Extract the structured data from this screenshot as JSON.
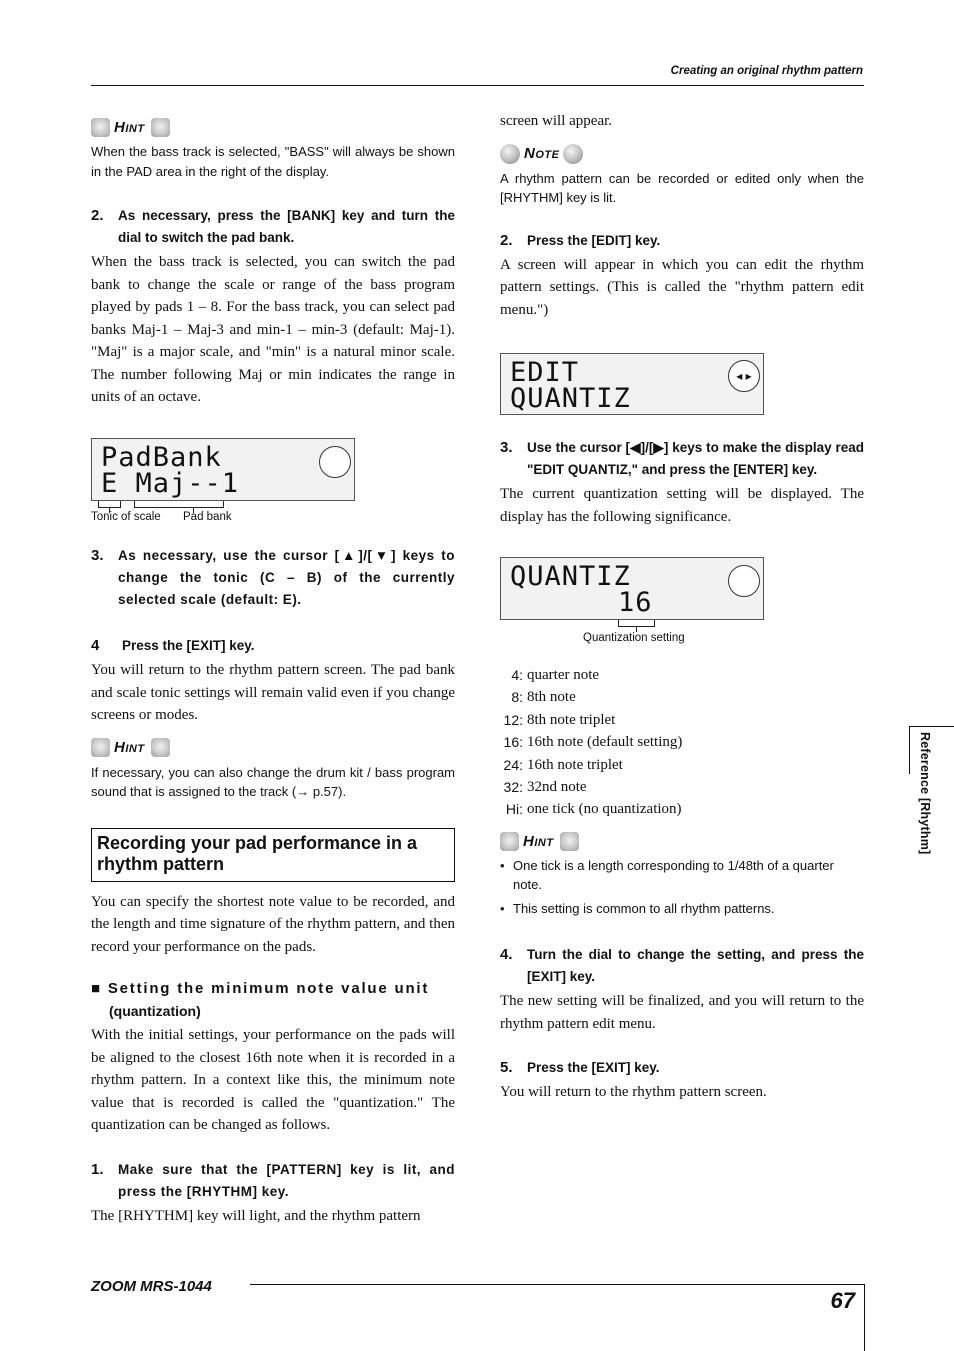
{
  "header": {
    "title": "Creating an original rhythm pattern"
  },
  "left": {
    "hint1": {
      "label": "Hint",
      "text": "When the bass track is selected, \"BASS\" will always be shown in the PAD area in the right of the display."
    },
    "step2": {
      "num": "2.",
      "text": "As necessary, press the [BANK] key and turn the dial to switch the pad bank."
    },
    "step2_body": "When the bass track is selected, you can switch the pad bank to change the scale or range of the bass program played by pads 1 – 8. For the bass track, you can select pad banks Maj-1 – Maj-3 and min-1 – min-3 (default: Maj-1). \"Maj\" is a major scale, and \"min\" is a natural minor scale. The number following Maj or min indicates the range in units of an octave.",
    "lcd1": {
      "line1": "PadBank",
      "line2": "E Maj--1",
      "caption_tonic": "Tonic of scale",
      "caption_bank": "Pad bank"
    },
    "step3": {
      "num": "3.",
      "text": "As necessary, use the cursor [▲]/[▼] keys to change the tonic (C – B) of the currently selected scale (default: E)."
    },
    "step4": {
      "num": "4",
      "text": "Press the [EXIT] key."
    },
    "step4_body": "You will return to the rhythm pattern screen. The pad bank and scale tonic settings will remain valid even if you change screens or modes.",
    "hint2": {
      "label": "Hint",
      "text": "If necessary, you can also change the drum kit / bass program sound that is assigned to the track (→ p.57)."
    },
    "section_title": "Recording your pad performance in a rhythm pattern",
    "section_body": "You can specify the shortest note value to be recorded, and the length and time signature of the rhythm pattern, and then record your performance on the pads.",
    "subhead": {
      "line1": "Setting the minimum note value unit",
      "line2": "(quantization)"
    },
    "sub_body": "With the initial settings, your performance on the pads will be aligned to the closest 16th note when it is recorded in a rhythm pattern. In a context like this, the minimum note value that is recorded is called the \"quantization.\" The quantization can be changed as follows.",
    "step1": {
      "num": "1.",
      "text": "Make sure that the [PATTERN] key is lit, and press the [RHYTHM] key."
    },
    "step1_body": "The [RHYTHM] key will light, and the rhythm pattern"
  },
  "right": {
    "cont": "screen will appear.",
    "note": {
      "label": "Note",
      "text": "A rhythm pattern can be recorded or edited only when the [RHYTHM] key is lit."
    },
    "step2": {
      "num": "2.",
      "text": "Press the [EDIT] key."
    },
    "step2_body": "A screen will appear in which you can edit the rhythm pattern settings. (This is called the \"rhythm pattern edit menu.\")",
    "lcd2": {
      "line1": "EDIT",
      "line2": "QUANTIZ",
      "arrows": "◂ ▸"
    },
    "step3": {
      "num": "3.",
      "text": "Use the cursor [◀]/[▶] keys to make the display read \"EDIT QUANTIZ,\" and press the [ENTER] key."
    },
    "step3_body": "The current quantization setting will be displayed. The display has the following significance.",
    "lcd3": {
      "line1": "QUANTIZ",
      "line2": "16",
      "caption": "Quantization setting"
    },
    "quantize_list": [
      {
        "key": "4:",
        "desc": "quarter note"
      },
      {
        "key": "8:",
        "desc": "8th note"
      },
      {
        "key": "12:",
        "desc": "8th note triplet"
      },
      {
        "key": "16:",
        "desc": "16th note (default setting)"
      },
      {
        "key": "24:",
        "desc": "16th note triplet"
      },
      {
        "key": "32:",
        "desc": "32nd note"
      },
      {
        "key": "Hi:",
        "desc": "one tick (no quantization)"
      }
    ],
    "hint": {
      "label": "Hint",
      "bullets": [
        "One tick is a length corresponding to 1/48th of a quarter note.",
        "This setting is common to all rhythm patterns."
      ]
    },
    "step4": {
      "num": "4.",
      "text": "Turn the dial to change the setting, and press the [EXIT] key."
    },
    "step4_body": "The new setting will be finalized, and you will return to the rhythm pattern edit menu.",
    "step5": {
      "num": "5.",
      "text": "Press the [EXIT] key."
    },
    "step5_body": "You will return to the rhythm pattern screen."
  },
  "side_tab": "Reference [Rhythm]",
  "footer": {
    "brand": "ZOOM MRS-1044",
    "page": "67"
  }
}
